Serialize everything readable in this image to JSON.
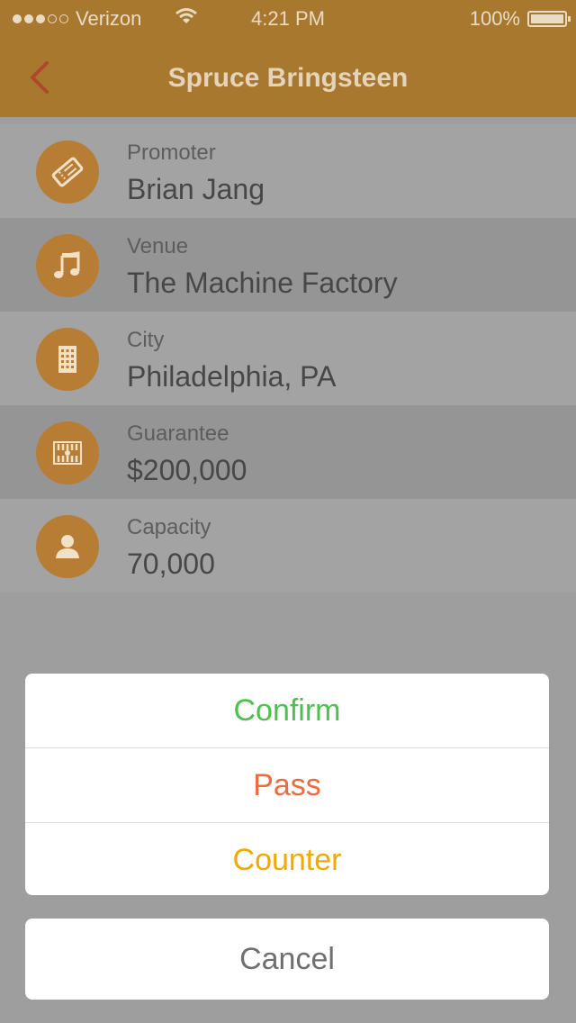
{
  "status_bar": {
    "carrier": "Verizon",
    "time": "4:21 PM",
    "battery": "100%"
  },
  "nav": {
    "title": "Spruce Bringsteen",
    "back_icon": "chevron-left-icon"
  },
  "details": [
    {
      "label": "Promoter",
      "value": "Brian Jang",
      "icon": "ticket-icon"
    },
    {
      "label": "Venue",
      "value": "The Machine Factory",
      "icon": "music-note-icon"
    },
    {
      "label": "City",
      "value": "Philadelphia, PA",
      "icon": "building-icon"
    },
    {
      "label": "Guarantee",
      "value": "$200,000",
      "icon": "money-icon"
    },
    {
      "label": "Capacity",
      "value": "70,000",
      "icon": "person-icon"
    }
  ],
  "action_sheet": {
    "options": [
      {
        "label": "Confirm",
        "color": "#4cc24c"
      },
      {
        "label": "Pass",
        "color": "#f06a3e"
      },
      {
        "label": "Counter",
        "color": "#f5a800"
      }
    ],
    "cancel_label": "Cancel"
  },
  "colors": {
    "accent": "#b77d35",
    "nav_bg": "#a8782f"
  }
}
